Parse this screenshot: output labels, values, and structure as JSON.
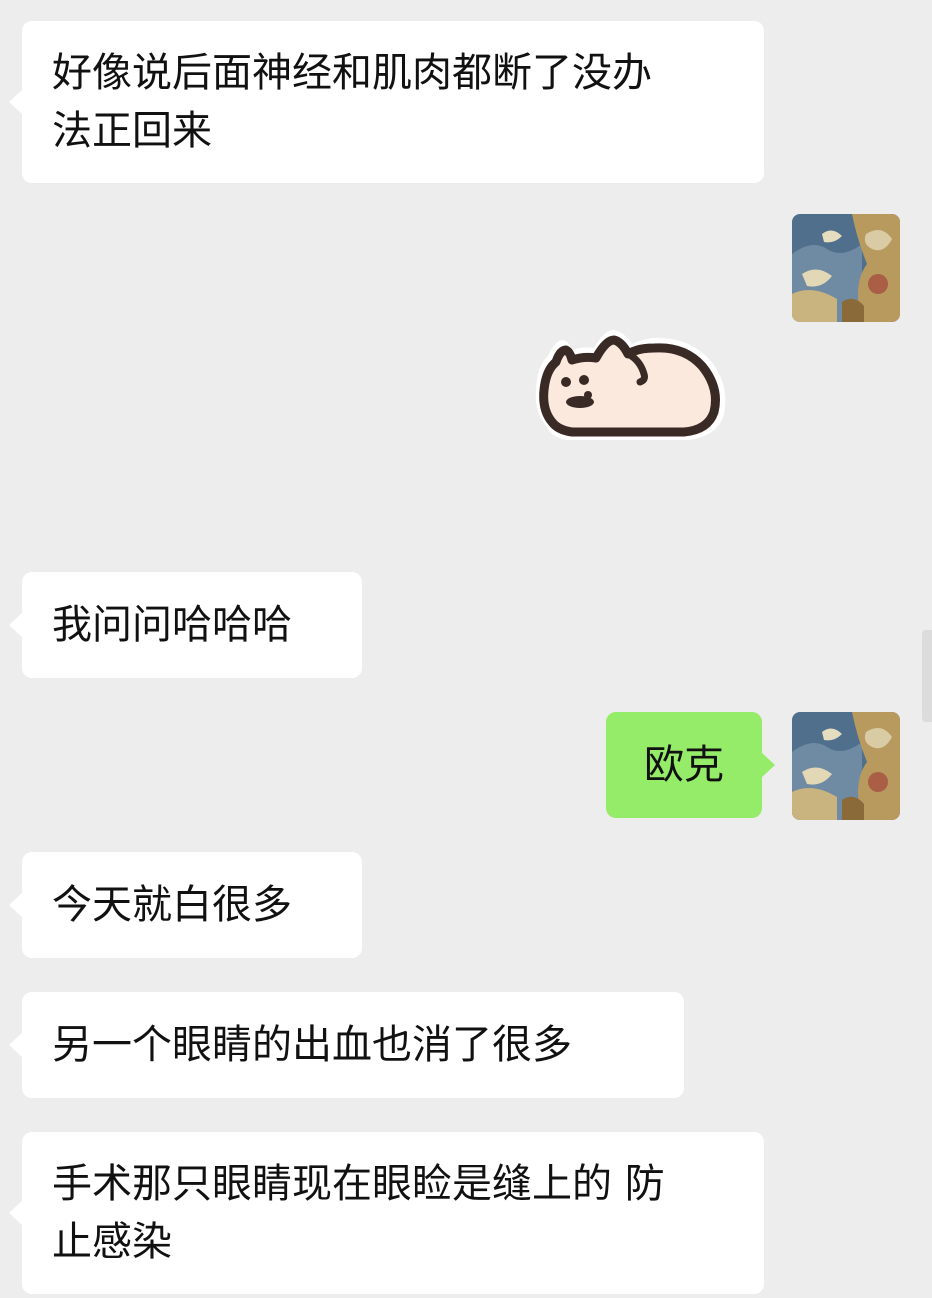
{
  "chat": {
    "messages": [
      {
        "side": "in",
        "text": "好像说后面神经和肌肉都断了没办\n法正回来"
      },
      {
        "side": "out",
        "type": "sticker",
        "sticker": "cat-loaf-sticker"
      },
      {
        "side": "in",
        "text": "我问问哈哈哈"
      },
      {
        "side": "out",
        "text": "欧克"
      },
      {
        "side": "in",
        "text": "今天就白很多"
      },
      {
        "side": "in",
        "text": "另一个眼睛的出血也消了很多"
      },
      {
        "side": "in",
        "text": "手术那只眼睛现在眼睑是缝上的 防\n止感染"
      }
    ]
  },
  "colors": {
    "background": "#ededed",
    "incoming_bubble": "#ffffff",
    "outgoing_bubble": "#95ec69",
    "text": "#111111"
  },
  "icons": {
    "self_avatar": "landscape-painting-avatar",
    "sticker": "cat-loaf-sticker"
  }
}
